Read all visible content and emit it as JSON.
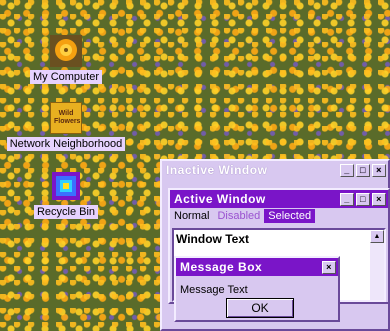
{
  "desktop": {
    "icons": [
      {
        "label": "My Computer",
        "icon": "poppy-icon"
      },
      {
        "label": "Network Neighborhood",
        "icon": "wild-flowers-icon",
        "art_text": "Wild Flowers"
      },
      {
        "label": "Recycle Bin",
        "icon": "recycle-bin-icon"
      }
    ]
  },
  "inactive_window": {
    "title": "Inactive Window",
    "buttons": [
      "_",
      "□",
      "×"
    ]
  },
  "active_window": {
    "title": "Active Window",
    "buttons": [
      "_",
      "□",
      "×"
    ],
    "menu": {
      "normal": "Normal",
      "disabled": "Disabled",
      "selected": "Selected"
    },
    "window_text": "Window Text"
  },
  "message_box": {
    "title": "Message Box",
    "text": "Message Text",
    "ok": "OK",
    "close": "×"
  },
  "colors": {
    "accent": "#7a15c8",
    "face": "#d8c8f0",
    "label_bg": "#e6d2ff",
    "disabled": "#9a52d0"
  }
}
